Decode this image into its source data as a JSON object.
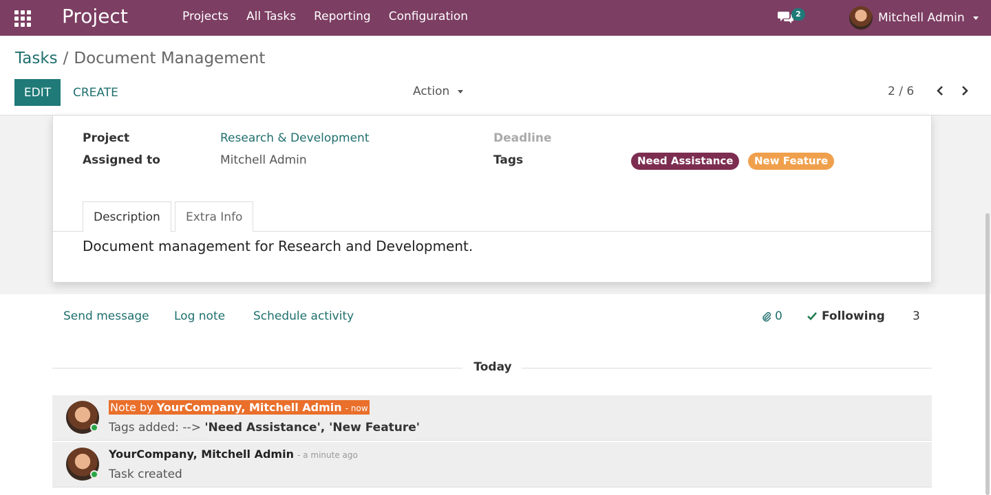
{
  "navbar": {
    "app_name": "Project",
    "menu": [
      "Projects",
      "All Tasks",
      "Reporting",
      "Configuration"
    ],
    "messages_badge": "2",
    "user_name": "Mitchell Admin",
    "bg_color": "#7c3e62"
  },
  "control_panel": {
    "breadcrumb_parent": "Tasks",
    "breadcrumb_separator": "/",
    "breadcrumb_current": "Document Management",
    "edit_label": "EDIT",
    "create_label": "CREATE",
    "action_label": "Action",
    "pager": "2 / 6"
  },
  "form": {
    "project_label": "Project",
    "project_value": "Research & Development",
    "assigned_label": "Assigned to",
    "assigned_value": "Mitchell Admin",
    "deadline_label": "Deadline",
    "tags_label": "Tags",
    "tags": [
      {
        "label": "Need Assistance",
        "color": "#7c2d50"
      },
      {
        "label": "New Feature",
        "color": "#f0a04d"
      }
    ],
    "tabs": [
      "Description",
      "Extra Info"
    ],
    "description": "Document management for Research and  Development."
  },
  "chatter": {
    "send_message": "Send message",
    "log_note": "Log note",
    "schedule_activity": "Schedule activity",
    "attachments_count": "0",
    "following_label": "Following",
    "followers_count": "3",
    "day_separator": "Today",
    "messages": [
      {
        "prefix": "Note by",
        "author": "YourCompany, Mitchell Admin",
        "time": "- now",
        "body_prefix": "Tags added: -->",
        "body_values": "'Need Assistance', 'New Feature'"
      },
      {
        "author": "YourCompany, Mitchell Admin",
        "time": "- a minute ago",
        "body": "Task created"
      }
    ]
  }
}
